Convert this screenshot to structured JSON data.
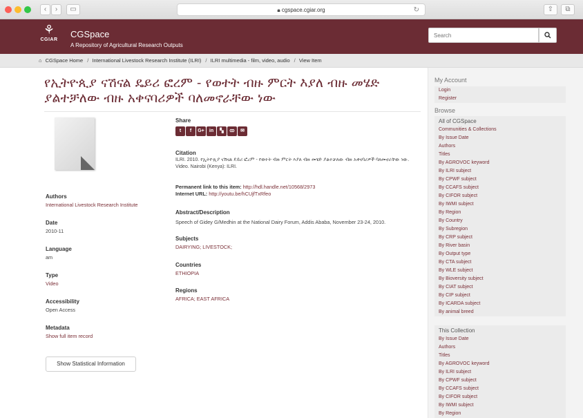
{
  "browser": {
    "url": "cgspace.cgiar.org",
    "back_icon": "chevron-left-icon",
    "forward_icon": "chevron-right-icon"
  },
  "header": {
    "brand_short": "CGIAR",
    "site_name": "CGSpace",
    "site_subtitle": "A Repository of Agricultural Research Outputs",
    "search_placeholder": "Search",
    "brand_color": "#6b2c34"
  },
  "breadcrumb": {
    "items": [
      "CGSpace Home",
      "International Livestock Research Institute (ILRI)",
      "ILRI multimedia - film, video, audio",
      "View Item"
    ],
    "separator": "/"
  },
  "item": {
    "title": "የኢትዮጲያ ናሽናል ዴይሪ ፎረም - የወተት ብዙ ምርት እያለ ብዙ መሄድ ያልተቻለው ብዙ አቀናባሪዎች ባለመኖራቸው ነው",
    "share_label": "Share",
    "share_icons": [
      "twitter-icon",
      "facebook-icon",
      "google-plus-icon",
      "linkedin-icon",
      "delicious-icon",
      "myspace-icon",
      "email-icon"
    ],
    "citation_label": "Citation",
    "citation_text": "ILRI. 2010. የኢትዮጲያ ናሽናል ዴይሪ ፎረም - የወተት ብዙ ምርት እያለ ብዙ መሄድ ያልተቻለው ብዙ አቀናባሪዎች ባለመኖራቸው ነው. Video. Nairobi (Kenya): ILRI.",
    "permalink_label": "Permanent link to this item:",
    "permalink_value": "http://hdl.handle.net/10568/2973",
    "internet_url_label": "Internet URL:",
    "internet_url_value": "http://youtu.be/hCUjfTxRfeo",
    "abstract_label": "Abstract/Description",
    "abstract_text": "Speech of Gidey G/Medhin at the National Dairy Forum, Addis Ababa, November 23-24, 2010.",
    "subjects_label": "Subjects",
    "subjects_value": "DAIRYING; LIVESTOCK;",
    "countries_label": "Countries",
    "countries_value": "ETHIOPIA",
    "regions_label": "Regions",
    "regions_value": "AFRICA; EAST AFRICA",
    "authors_label": "Authors",
    "authors_value": "International Livestock Research Institute",
    "date_label": "Date",
    "date_value": "2010-11",
    "language_label": "Language",
    "language_value": "am",
    "type_label": "Type",
    "type_value": "Video",
    "accessibility_label": "Accessibility",
    "accessibility_value": "Open Access",
    "metadata_label": "Metadata",
    "metadata_link": "Show full item record",
    "stat_button": "Show Statistical Information"
  },
  "sidebar": {
    "account_heading": "My Account",
    "account_items": [
      "Login",
      "Register"
    ],
    "browse_heading": "Browse",
    "all_heading": "All of CGSpace",
    "all_items": [
      "Communities & Collections",
      "By Issue Date",
      "Authors",
      "Titles",
      "By AGROVOC keyword",
      "By ILRI subject",
      "By CPWF subject",
      "By CCAFS subject",
      "By CIFOR subject",
      "By IWMI subject",
      "By Region",
      "By Country",
      "By Subregion",
      "By CRP subject",
      "By River basin",
      "By Output type",
      "By CTA subject",
      "By WLE subject",
      "By Bioversity subject",
      "By CIAT subject",
      "By CIP subject",
      "By ICARDA subject",
      "By animal breed"
    ],
    "collection_heading": "This Collection",
    "collection_items": [
      "By Issue Date",
      "Authors",
      "Titles",
      "By AGROVOC keyword",
      "By ILRI subject",
      "By CPWF subject",
      "By CCAFS subject",
      "By CIFOR subject",
      "By IWMI subject",
      "By Region"
    ]
  }
}
